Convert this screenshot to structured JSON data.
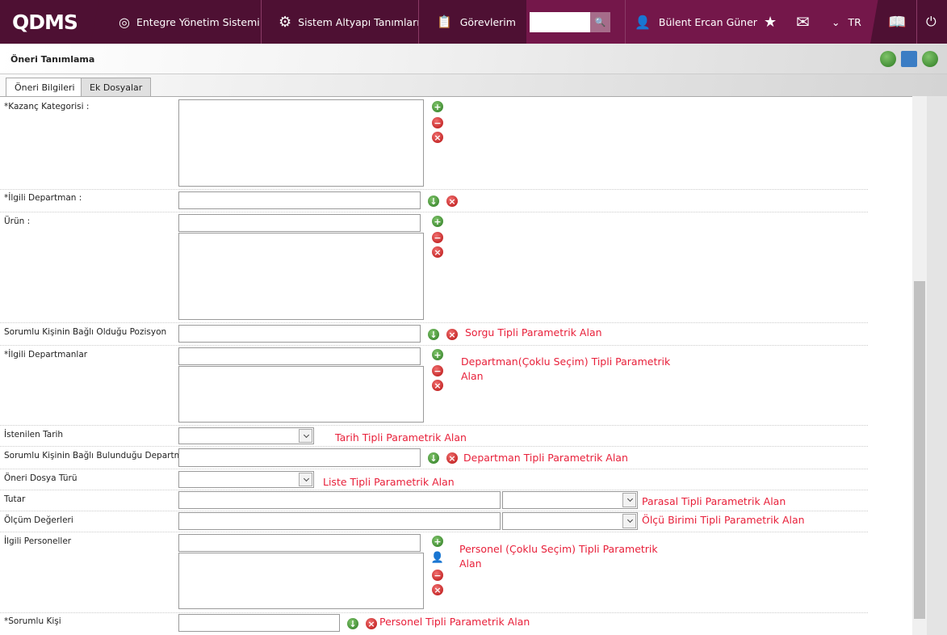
{
  "header": {
    "logo": "QDMS",
    "nav": [
      "Entegre Yönetim Sistemi",
      "Sistem Altyapı Tanımları",
      "Görevlerim"
    ],
    "user": "Bülent Ercan Güner",
    "lang": "TR",
    "search_placeholder": ""
  },
  "page": {
    "title": "Öneri Tanımlama",
    "tabs": [
      "Öneri Bilgileri",
      "Ek Dosyalar"
    ]
  },
  "fields": [
    {
      "label": "*Kazanç Kategorisi :"
    },
    {
      "label": "*İlgili Departman :"
    },
    {
      "label": "Ürün :"
    },
    {
      "label": "Sorumlu Kişinin Bağlı Olduğu Pozisyon",
      "note": "Sorgu Tipli Parametrik Alan"
    },
    {
      "label": "*İlgili Departmanlar",
      "note": "Departman(Çoklu Seçim) Tipli Parametrik Alan"
    },
    {
      "label": "İstenilen Tarih",
      "note": "Tarih Tipli Parametrik Alan"
    },
    {
      "label": "Sorumlu Kişinin Bağlı Bulunduğu Departman",
      "note": "Departman Tipli Parametrik Alan"
    },
    {
      "label": "Öneri Dosya Türü",
      "note": "Liste Tipli Parametrik Alan"
    },
    {
      "label": "Tutar",
      "note": "Parasal Tipli Parametrik Alan"
    },
    {
      "label": "Ölçüm Değerleri",
      "note": "Ölçü Birimi Tipli Parametrik Alan"
    },
    {
      "label": "İlgili Personeller",
      "note": "Personel (Çoklu Seçim) Tipli Parametrik Alan"
    },
    {
      "label": "*Sorumlu Kişi",
      "note": "Personel Tipli Parametrik Alan"
    }
  ],
  "colors": {
    "header": "#74174a",
    "header_dark": "#4e1033",
    "note": "#e8203a"
  }
}
